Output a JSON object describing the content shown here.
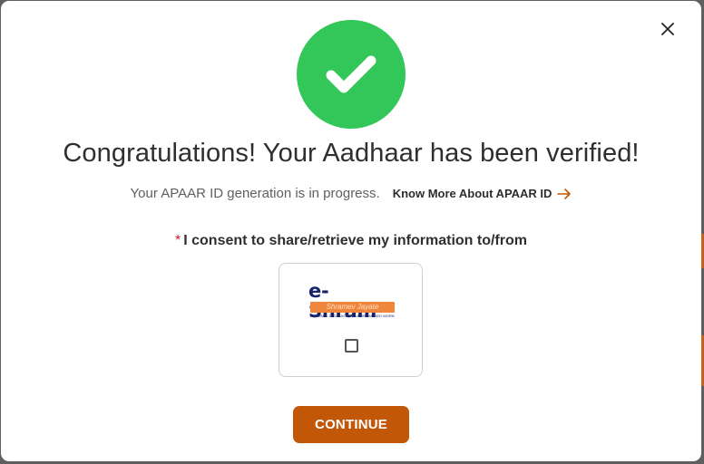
{
  "dialog": {
    "title": "Congratulations! Your Aadhaar has been verified!",
    "subtitle": "Your APAAR ID generation is in progress.",
    "know_more_label": "Know More About APAAR ID",
    "consent_required_mark": "*",
    "consent_label": "I consent to share/retrieve my information to/from",
    "partner": {
      "logo_name": "e-Shram",
      "logo_tagline": "Shramev Jayate",
      "logo_fine_print": "NATIONAL DATABASE OF UNORGANISED WORKERS",
      "checked": false
    },
    "continue_label": "CONTINUE"
  },
  "colors": {
    "success": "#33c659",
    "primary_button": "#c25707",
    "link_arrow": "#c25707",
    "required": "#d0202a"
  },
  "icons": {
    "close": "close-icon",
    "success": "checkmark-icon",
    "arrow": "arrow-right-icon"
  }
}
